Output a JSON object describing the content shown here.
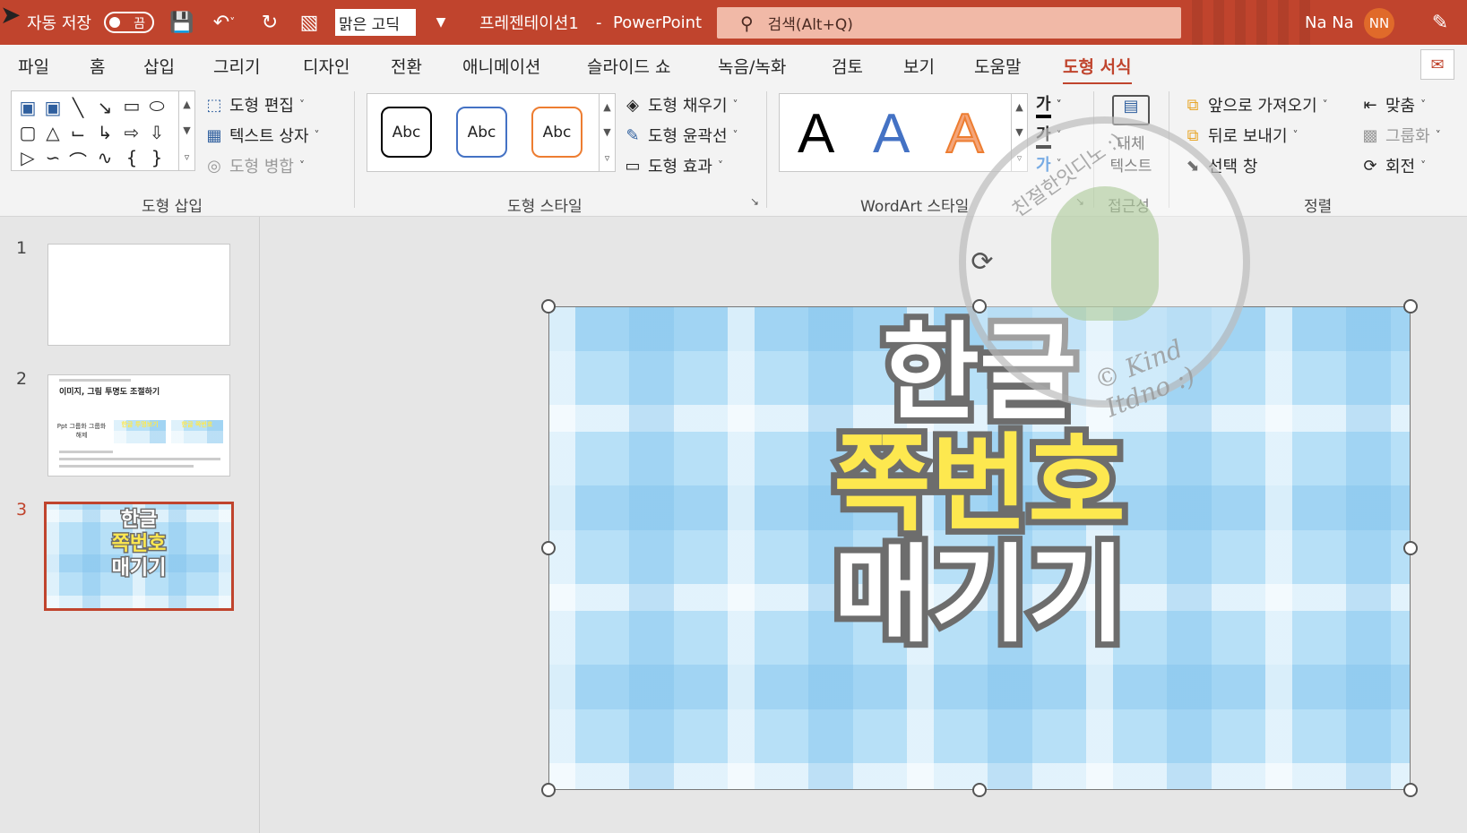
{
  "titlebar": {
    "autosave_label": "자동 저장",
    "autosave_state": "끔",
    "font_name": "맑은 고딕",
    "doc_title": "프레젠테이션1",
    "separator": "-",
    "app_name": "PowerPoint",
    "search_placeholder": "검색(Alt+Q)",
    "user_name": "Na Na",
    "user_initials": "NN",
    "bg_color": "#c0442d"
  },
  "tabs": [
    "파일",
    "홈",
    "삽입",
    "그리기",
    "디자인",
    "전환",
    "애니메이션",
    "슬라이드 쇼",
    "녹음/녹화",
    "검토",
    "보기",
    "도움말",
    "도형 서식"
  ],
  "active_tab": "도형 서식",
  "ribbon": {
    "insert_shapes": {
      "label": "도형 삽입",
      "edit_shape": "도형 편집",
      "text_box": "텍스트 상자",
      "merge_shapes": "도형 병합"
    },
    "shape_styles": {
      "label": "도형 스타일",
      "samples": [
        "Abc",
        "Abc",
        "Abc"
      ],
      "fill": "도형 채우기",
      "outline": "도형 윤곽선",
      "effects": "도형 효과"
    },
    "wordart": {
      "label": "WordArt 스타일",
      "samples": [
        "A",
        "A",
        "A"
      ],
      "text_glyph": "가"
    },
    "accessibility": {
      "label": "접근성",
      "alt_text_line1": "대체",
      "alt_text_line2": "텍스트"
    },
    "arrange": {
      "label": "정렬",
      "bring_forward": "앞으로 가져오기",
      "send_backward": "뒤로 보내기",
      "selection_pane": "선택 창",
      "align": "맞춤",
      "group": "그룹화",
      "rotate": "회전"
    }
  },
  "slides": [
    {
      "number": "1"
    },
    {
      "number": "2",
      "title": "이미지, 그림 투명도 조절하기",
      "card1": "Ppt 그룹화 그룹화 해제",
      "card2": "한글 투명보기",
      "card3": "한글 쪽번호"
    },
    {
      "number": "3",
      "line1": "한글",
      "line2": "쪽번호",
      "line3": "매기기"
    }
  ],
  "active_slide": "3",
  "canvas": {
    "line1": "한글",
    "line2": "쪽번호",
    "line3": "매기기",
    "line2_color": "#fde84f"
  },
  "watermark": {
    "text": "© Kind Itdno :)",
    "top_text": "친절한잇디노 :)"
  }
}
